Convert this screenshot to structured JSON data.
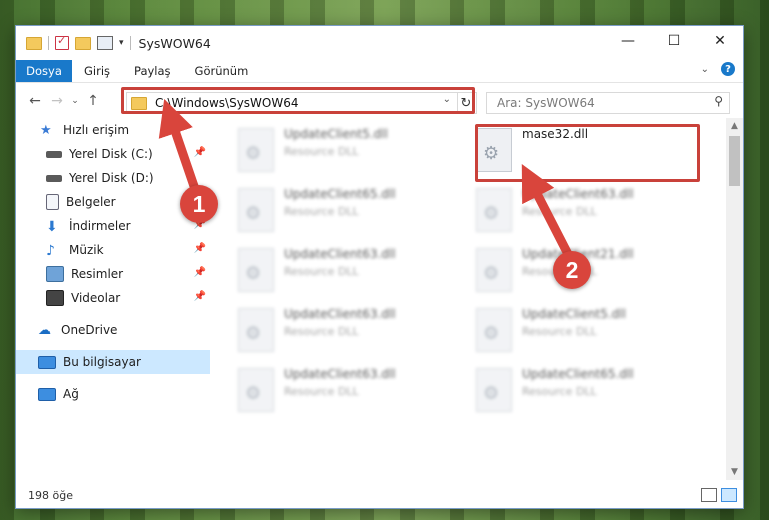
{
  "window": {
    "title": "SysWOW64",
    "controls": [
      "minimize-icon",
      "maximize-icon",
      "close-icon"
    ]
  },
  "ribbon": {
    "tabs": [
      "Dosya",
      "Giriş",
      "Paylaş",
      "Görünüm"
    ],
    "active_tab": "Dosya"
  },
  "address": {
    "path": "C:\\Windows\\SysWOW64",
    "search_placeholder": "Ara: SysWOW64"
  },
  "sidebar": {
    "quick_access": "Hızlı erişim",
    "items": [
      {
        "label": "Yerel Disk (C:)",
        "pinned": true
      },
      {
        "label": "Yerel Disk (D:)",
        "pinned": false
      },
      {
        "label": "Belgeler",
        "pinned": true
      },
      {
        "label": "İndirmeler",
        "pinned": true
      },
      {
        "label": "Müzik",
        "pinned": true
      },
      {
        "label": "Resimler",
        "pinned": true
      },
      {
        "label": "Videolar",
        "pinned": true
      }
    ],
    "onedrive": "OneDrive",
    "this_pc": "Bu bilgisayar",
    "network": "Ağ"
  },
  "files": {
    "highlighted": {
      "name": "mase32.dll"
    },
    "left_column": [
      {
        "name": "UpdateClient5.dll",
        "type": "Resource DLL"
      },
      {
        "name": "UpdateClient65.dll",
        "type": "Resource DLL"
      },
      {
        "name": "UpdateClient63.dll",
        "type": "Resource DLL"
      },
      {
        "name": "UpdateClient63.dll",
        "type": "Resource DLL"
      },
      {
        "name": "UpdateClient63.dll",
        "type": "Resource DLL"
      }
    ],
    "right_column": [
      {
        "name": "UpdateClient63.dll",
        "type": "Resource DLL"
      },
      {
        "name": "UpdateClient21.dll",
        "type": "Resource DLL"
      },
      {
        "name": "UpdateClient5.dll",
        "type": "Resource DLL"
      },
      {
        "name": "UpdateClient65.dll",
        "type": "Resource DLL"
      }
    ]
  },
  "status": {
    "item_count": "198 öğe"
  },
  "markers": {
    "one": "1",
    "two": "2"
  },
  "colors": {
    "accent": "#1979ca",
    "highlight": "#c9413a",
    "selected": "#cce8ff"
  }
}
